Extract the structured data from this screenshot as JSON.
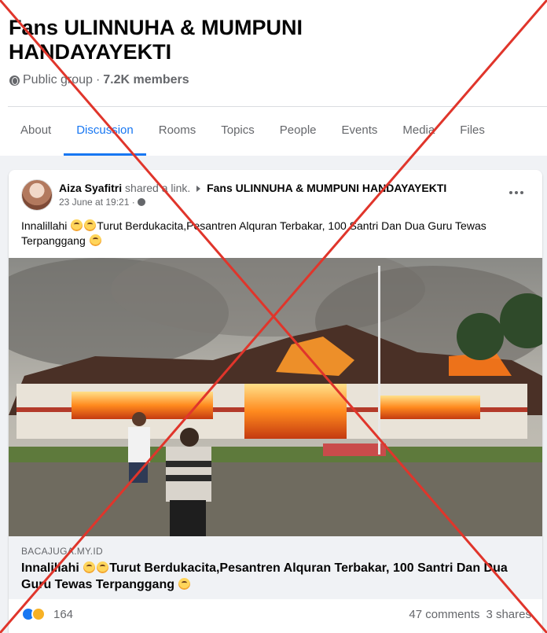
{
  "group": {
    "title": "Fans ULINNUHA & MUMPUNI HANDAYAYEKTI",
    "privacy": "Public group",
    "separator": "·",
    "members": "7.2K members"
  },
  "tabs": [
    {
      "label": "About",
      "active": false
    },
    {
      "label": "Discussion",
      "active": true
    },
    {
      "label": "Rooms",
      "active": false
    },
    {
      "label": "Topics",
      "active": false
    },
    {
      "label": "People",
      "active": false
    },
    {
      "label": "Events",
      "active": false
    },
    {
      "label": "Media",
      "active": false
    },
    {
      "label": "Files",
      "active": false
    }
  ],
  "post": {
    "author": "Aiza Syafitri",
    "action": "shared a link.",
    "target_group": "Fans ULINNUHA & MUMPUNI HANDAYAYEKTI",
    "time": "23 June at 19:21 ·",
    "text_part1": "Innalillahi",
    "text_part2": "Turut Berdukacita,Pesantren Alquran Terbakar, 100 Santri Dan Dua Guru Tewas Terpanggang",
    "link_domain": "BACAJUGA.MY.ID",
    "link_title_part1": "Innalillahi",
    "link_title_part2": "Turut Berdukacita,Pesantren Alquran Terbakar, 100 Santri Dan Dua Guru Tewas Terpanggang",
    "reaction_count": "164",
    "comments": "47 comments",
    "shares": "3 shares"
  },
  "colors": {
    "accent": "#1877f2",
    "cross": "#e0352b",
    "muted": "#65676b"
  }
}
